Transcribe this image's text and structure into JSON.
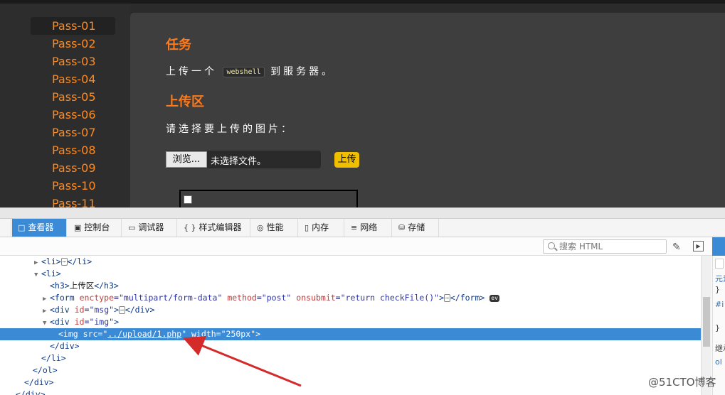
{
  "sidebar": {
    "items": [
      "Pass-01",
      "Pass-02",
      "Pass-03",
      "Pass-04",
      "Pass-05",
      "Pass-06",
      "Pass-07",
      "Pass-08",
      "Pass-09",
      "Pass-10",
      "Pass-11"
    ]
  },
  "content": {
    "task_heading": "任务",
    "task_text_before": "上传一个",
    "task_code": "webshell",
    "task_text_after": "到服务器。",
    "upload_heading": "上传区",
    "choose_text": "请选择要上传的图片：",
    "browse_label": "浏览...",
    "no_file_label": "未选择文件。",
    "upload_button": "上传"
  },
  "devtools": {
    "tabs": [
      {
        "icon": "□",
        "label": "查看器"
      },
      {
        "icon": "▣",
        "label": "控制台"
      },
      {
        "icon": "▭",
        "label": "调试器"
      },
      {
        "icon": "{ }",
        "label": "样式编辑器"
      },
      {
        "icon": "◎",
        "label": "性能"
      },
      {
        "icon": "▯",
        "label": "内存"
      },
      {
        "icon": "≡",
        "label": "网络"
      },
      {
        "icon": "⛁",
        "label": "存储"
      }
    ],
    "search_placeholder": "搜索 HTML",
    "tree": {
      "l1": "<li>",
      "l1b": "</li>",
      "l2": "<li>",
      "l3_open": "<h3>",
      "l3_text": "上传区",
      "l3_close": "</h3>",
      "l4_tag": "<form",
      "l4_attr1": "enctype",
      "l4_val1": "\"multipart/form-data\"",
      "l4_attr2": "method",
      "l4_val2": "\"post\"",
      "l4_attr3": "onsubmit",
      "l4_val3": "\"return checkFile()\"",
      "l4_close": ">",
      "l4_end": "</form>",
      "l4_badge": "ev",
      "l5_tag": "<div",
      "l5_attr": "id",
      "l5_val": "\"msg\"",
      "l5_end": "</div>",
      "l6_tag": "<div",
      "l6_attr": "id",
      "l6_val": "\"img\"",
      "l7_tag": "<img",
      "l7_attr1": "src",
      "l7_val1_q": "\"",
      "l7_val1": "../upload/1.php",
      "l7_attr2": "width",
      "l7_val2": "\"250px\"",
      "l7_close": ">",
      "l8": "</div>",
      "l9": "</li>",
      "l10": "</ol>",
      "l11": "</div>",
      "l12": "</div>"
    },
    "right_panel": [
      "元素",
      "}",
      "#i",
      "}",
      "继承",
      "ol"
    ]
  },
  "watermark": "@51CTO博客",
  "colors": {
    "accent_orange": "#ff7a1a",
    "selection_blue": "#3b8ad6",
    "upload_yellow": "#f0c000",
    "arrow_red": "#d42a2a"
  }
}
